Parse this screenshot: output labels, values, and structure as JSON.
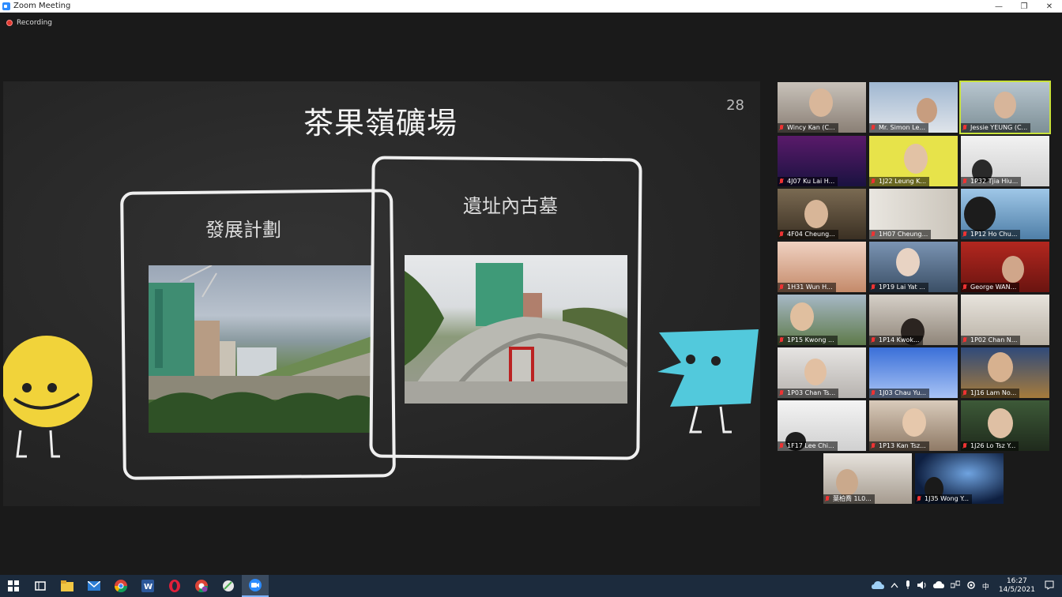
{
  "window": {
    "title": "Zoom Meeting",
    "minimize_glyph": "—",
    "restore_glyph": "❐",
    "close_glyph": "✕"
  },
  "recording": {
    "label": "Recording"
  },
  "slide": {
    "title": "茶果嶺礦場",
    "page_number": "28",
    "left_label": "發展計劃",
    "right_label": "遺址內古墓"
  },
  "participants": [
    {
      "name": "Wincy Kan (C..."
    },
    {
      "name": "Mr. Simon Le..."
    },
    {
      "name": "Jessie YEUNG (C..."
    },
    {
      "name": "4J07 Ku Lai H..."
    },
    {
      "name": "1J22 Leung K..."
    },
    {
      "name": "1P32 Tjia Hiu..."
    },
    {
      "name": "4F04 Cheung..."
    },
    {
      "name": "1H07 Cheung..."
    },
    {
      "name": "1P12 Ho Chu..."
    },
    {
      "name": "1H31 Wun H..."
    },
    {
      "name": "1P19 Lai Yat ..."
    },
    {
      "name": "George WAN..."
    },
    {
      "name": "1P15 Kwong ..."
    },
    {
      "name": "1P14 Kwok..."
    },
    {
      "name": "1P02 Chan N..."
    },
    {
      "name": "1P03 Chan Ts..."
    },
    {
      "name": "1J03 Chau Yu..."
    },
    {
      "name": "1J16 Lam No..."
    },
    {
      "name": "1F17 Lee Chi..."
    },
    {
      "name": "1P13 Kan Tsz..."
    },
    {
      "name": "1J26 Lo Tsz Y..."
    },
    {
      "name": "葉柏喬 1L0..."
    },
    {
      "name": "1J35 Wong Y..."
    }
  ],
  "taskbar": {
    "time": "16:27",
    "date": "14/5/2021",
    "ime": "中"
  },
  "colors": {
    "accent": "#2d8cff",
    "active_speaker": "#c9e23a",
    "recording": "#e0392e",
    "taskbar": "#1c2b3d"
  }
}
